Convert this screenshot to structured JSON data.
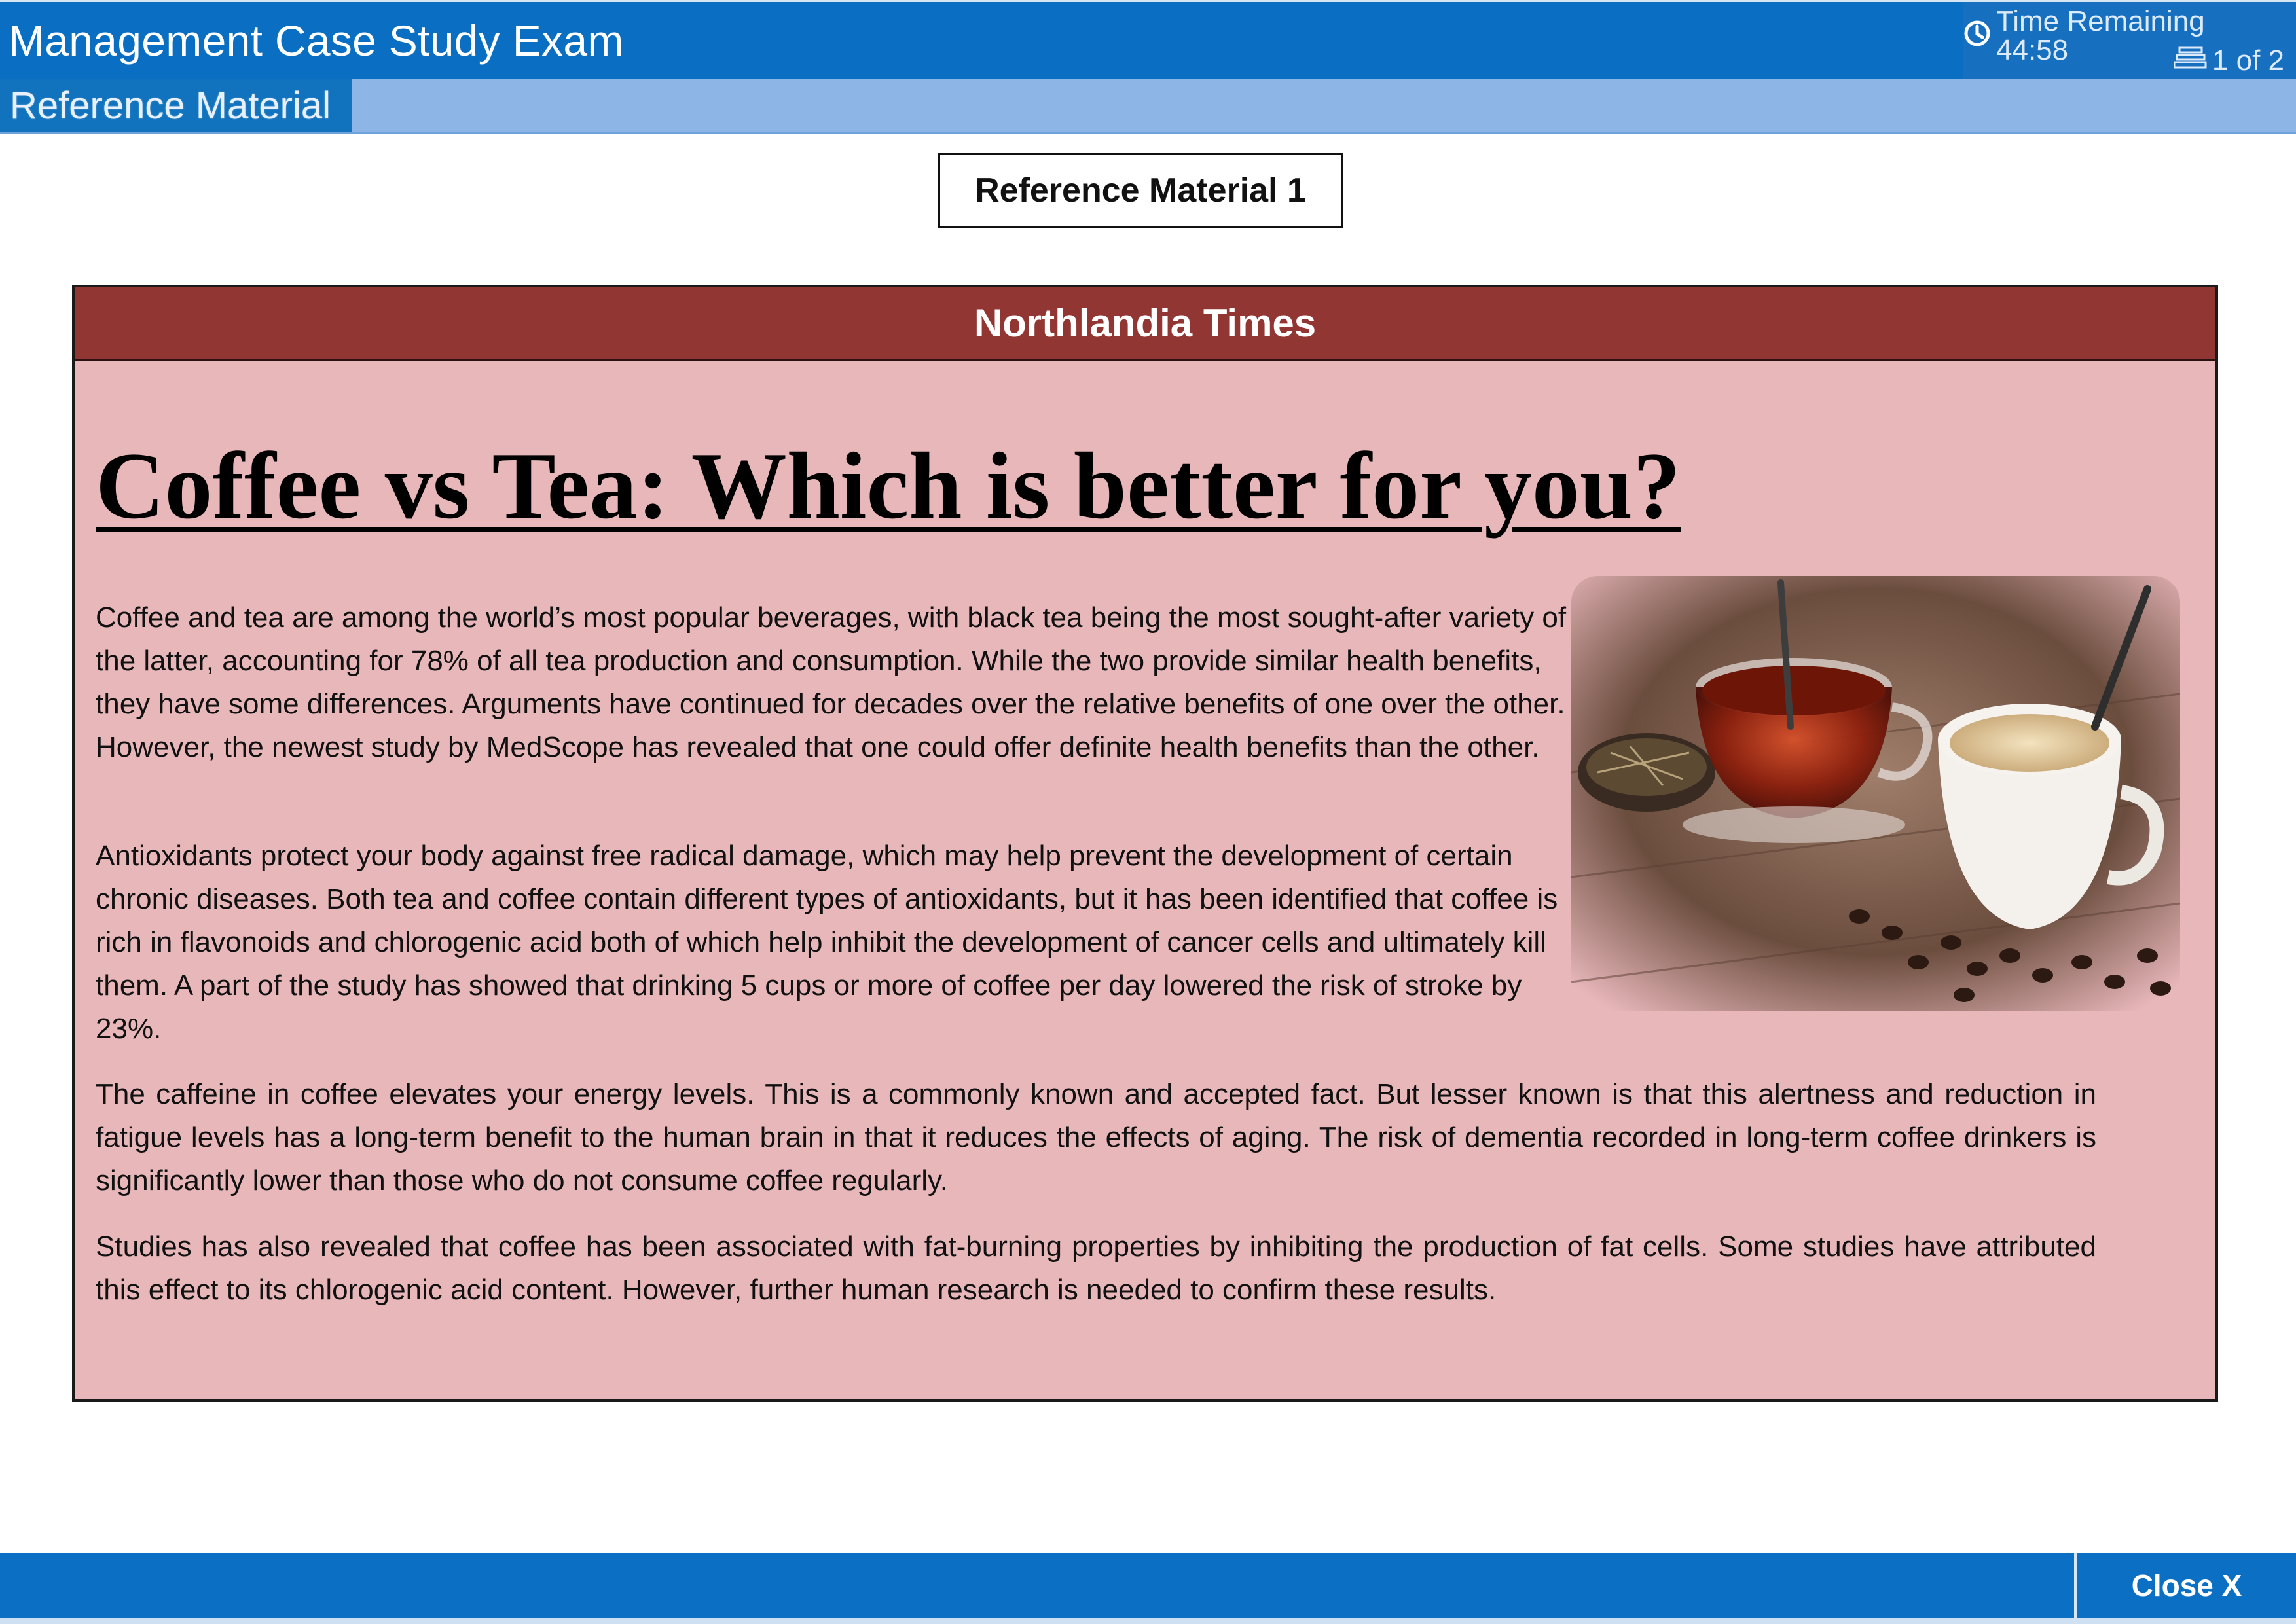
{
  "header": {
    "title": "Management Case Study Exam",
    "timer_label": "Time Remaining 44:58",
    "page_indicator": "1 of 2"
  },
  "subbar": {
    "tab_label": "Reference Material"
  },
  "reference": {
    "label": "Reference Material 1"
  },
  "article": {
    "masthead": "Northlandia Times",
    "headline": "Coffee vs Tea: Which is better for you?",
    "paragraphs": [
      "Coffee and tea are among the world’s most popular beverages, with black tea being the most sought-after variety of the latter, accounting for 78% of all tea production and consumption. While the two provide similar health benefits, they have some differences. Arguments have continued for decades over the relative benefits of one over the other. However, the newest study by MedScope has revealed that one could offer definite health benefits than the other.",
      "Antioxidants protect your body against free radical damage, which may help prevent the development of certain chronic diseases. Both tea and coffee contain different types of antioxidants, but it has been identified that coffee is rich in flavonoids and chlorogenic acid both of which help inhibit the development of cancer cells and ultimately kill them. A part of the study has showed that drinking 5 cups or more of coffee per day lowered the risk of stroke by 23%.",
      "The caffeine in coffee elevates your energy levels. This is a commonly known and accepted fact. But lesser known is that this alertness and reduction in fatigue levels has a long-term benefit to the human brain in that it reduces the effects of aging. The risk of dementia recorded in long-term coffee drinkers is significantly lower than those who do not consume coffee regularly.",
      "Studies has also revealed that coffee has been associated with fat-burning properties by inhibiting the production of fat cells. Some studies have attributed this effect to its chlorogenic acid content. However, further human research is needed to confirm these results."
    ]
  },
  "footer": {
    "close_label": "Close X"
  },
  "icons": {
    "timer": "clock-icon",
    "pages": "page-stack-icon"
  },
  "colors": {
    "header_blue": "#0a6fc2",
    "subbar_blue": "#8db5e6",
    "masthead_red": "#923634",
    "panel_pink": "#e8b7ba"
  }
}
